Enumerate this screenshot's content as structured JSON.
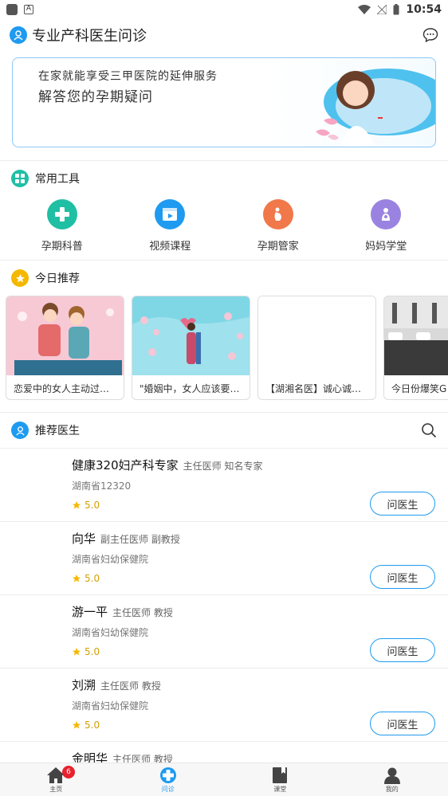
{
  "status_bar": {
    "time": "10:54"
  },
  "app_bar": {
    "title": "专业产科医生问诊"
  },
  "banner": {
    "line1": "在家就能享受三甲医院的延伸服务",
    "line2": "解答您的孕期疑问"
  },
  "tools_section": {
    "title": "常用工具",
    "items": [
      {
        "label": "孕期科普",
        "color": "#1fbfa4"
      },
      {
        "label": "视频课程",
        "color": "#1e9bf0"
      },
      {
        "label": "孕期管家",
        "color": "#f0784a"
      },
      {
        "label": "妈妈学堂",
        "color": "#9a83e0"
      }
    ]
  },
  "today_section": {
    "title": "今日推荐",
    "items": [
      {
        "caption": "恋爱中的女人主动过…"
      },
      {
        "caption": "\"婚姻中，女人应该要…"
      },
      {
        "caption": "【湖湘名医】诚心诚…"
      },
      {
        "caption": "今日份爆笑G"
      }
    ]
  },
  "doctors_section": {
    "title": "推荐医生",
    "doctors": [
      {
        "name": "健康320妇产科专家",
        "rank": "主任医师 知名专家",
        "hospital": "湖南省12320",
        "rating": "5.0",
        "button": "问医生"
      },
      {
        "name": "向华",
        "rank": "副主任医师 副教授",
        "hospital": "湖南省妇幼保健院",
        "rating": "5.0",
        "button": "问医生"
      },
      {
        "name": "游一平",
        "rank": "主任医师 教授",
        "hospital": "湖南省妇幼保健院",
        "rating": "5.0",
        "button": "问医生"
      },
      {
        "name": "刘溯",
        "rank": "主任医师 教授",
        "hospital": "湖南省妇幼保健院",
        "rating": "5.0",
        "button": "问医生"
      },
      {
        "name": "金明华",
        "rank": "主任医师 教授",
        "hospital": "",
        "rating": "",
        "button": ""
      }
    ]
  },
  "tab_bar": {
    "tabs": [
      {
        "label": "主页"
      },
      {
        "label": "问诊"
      },
      {
        "label": "课堂"
      },
      {
        "label": "我的"
      }
    ],
    "badge": "6"
  },
  "colors": {
    "accent": "#1e9bf0",
    "star": "#f5b800"
  }
}
